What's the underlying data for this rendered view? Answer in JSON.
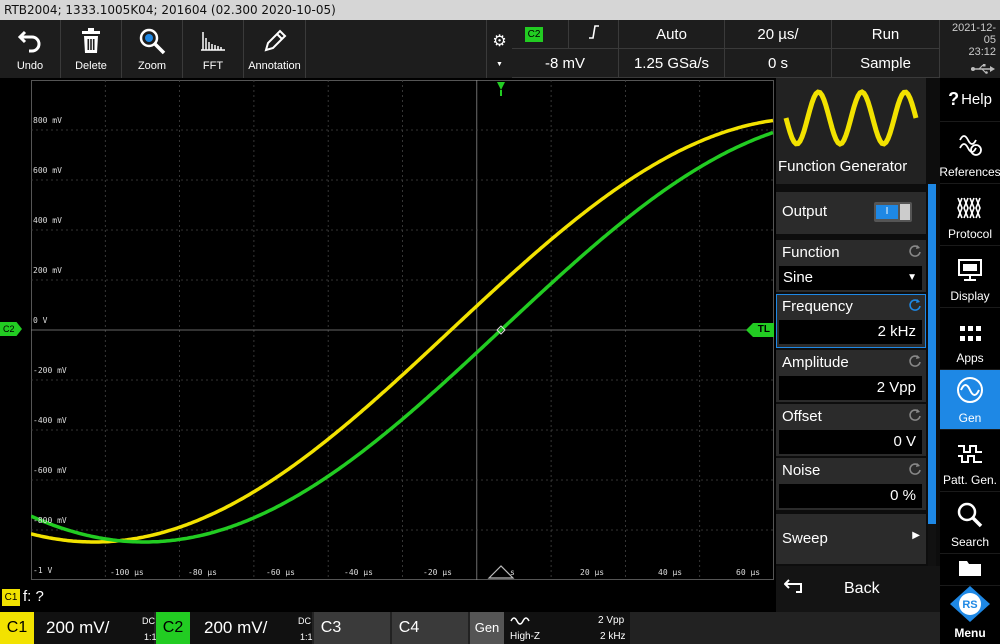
{
  "title_bar": "RTB2004; 1333.1005K04; 201604 (02.300 2020-10-05)",
  "toolbar": {
    "undo": "Undo",
    "delete": "Delete",
    "zoom": "Zoom",
    "fft": "FFT",
    "annotation": "Annotation"
  },
  "status": {
    "trigger_source": "C2",
    "trigger_level": "-8 mV",
    "trigger_mode": "Auto",
    "sample_rate": "1.25 GSa/s",
    "timebase": "20 µs/",
    "time_offset": "0 s",
    "run_state": "Run",
    "acq_mode": "Sample",
    "date": "2021-12-05",
    "time": "23:12"
  },
  "scope": {
    "y_labels": [
      "800 mV",
      "600 mV",
      "400 mV",
      "200 mV",
      "0 V",
      "-200 mV",
      "-400 mV",
      "-600 mV",
      "-800 mV",
      "-1 V"
    ],
    "x_labels": [
      "-100 µs",
      "-80 µs",
      "-60 µs",
      "-40 µs",
      "-20 µs",
      "s",
      "20 µs",
      "40 µs",
      "60 µs"
    ],
    "c2_marker": "C2",
    "tl_marker": "TL",
    "ch1_color": "#f2e200",
    "ch2_color": "#22cc22"
  },
  "fg": {
    "title": "Function Generator",
    "output_label": "Output",
    "output_state": "I",
    "function_label": "Function",
    "function_value": "Sine",
    "frequency_label": "Frequency",
    "frequency_value": "2 kHz",
    "amplitude_label": "Amplitude",
    "amplitude_value": "2 Vpp",
    "offset_label": "Offset",
    "offset_value": "0 V",
    "noise_label": "Noise",
    "noise_value": "0 %",
    "sweep_label": "Sweep",
    "back_label": "Back"
  },
  "menu": {
    "help": "Help",
    "references": "References",
    "protocol": "Protocol",
    "display": "Display",
    "apps": "Apps",
    "gen": "Gen",
    "patt_gen": "Patt. Gen.",
    "search": "Search",
    "menu": "Menu"
  },
  "formula": {
    "badge": "C1",
    "text": "f: ?"
  },
  "channels": {
    "c1_label": "C1",
    "c1_scale": "200 mV/",
    "c1_coupling": "DC",
    "c1_ratio": "1:1",
    "c2_label": "C2",
    "c2_scale": "200 mV/",
    "c2_coupling": "DC",
    "c2_ratio": "1:1",
    "c3_label": "C3",
    "c4_label": "C4",
    "gen_label": "Gen",
    "gen_load": "High-Z",
    "gen_amplitude": "2 Vpp",
    "gen_freq": "2 kHz"
  }
}
